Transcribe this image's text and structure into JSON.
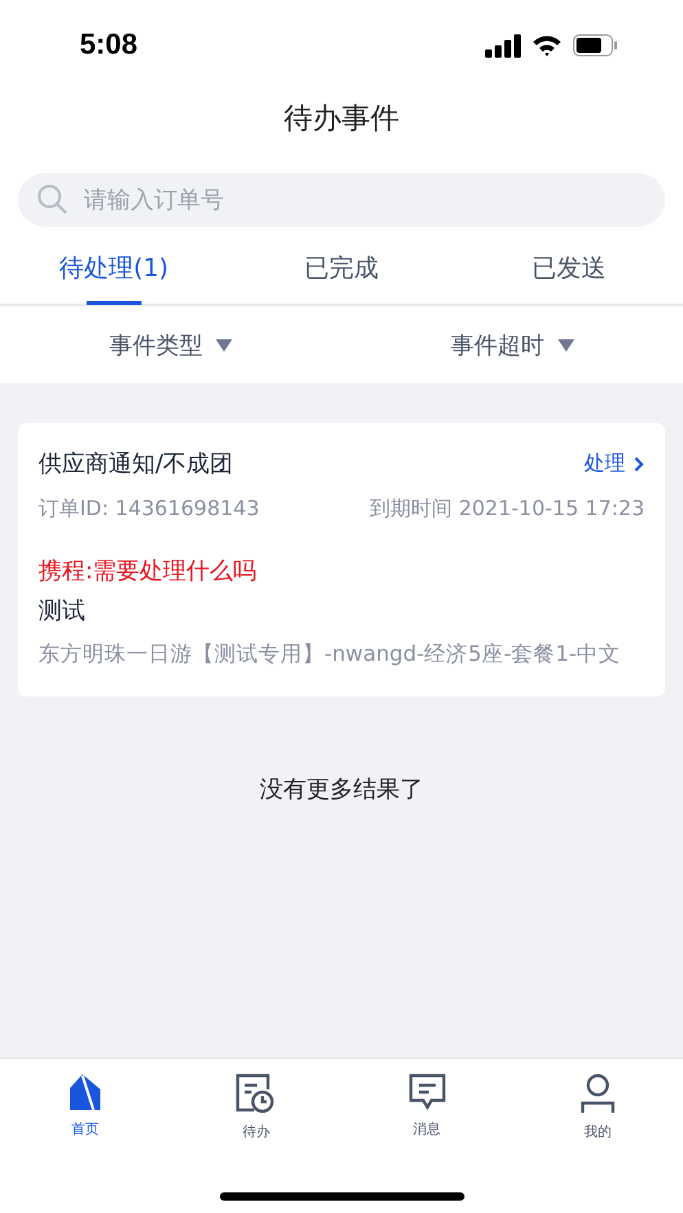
{
  "status_bar": {
    "time": "5:08"
  },
  "title": "待办事件",
  "search": {
    "placeholder": "请输入订单号"
  },
  "tabs": [
    {
      "label": "待处理(1)",
      "selected": true
    },
    {
      "label": "已完成",
      "selected": false
    },
    {
      "label": "已发送",
      "selected": false
    }
  ],
  "filters": [
    {
      "label": "事件类型"
    },
    {
      "label": "事件超时"
    }
  ],
  "events": [
    {
      "title": "供应商通知/不成团",
      "action": "处理",
      "order_id": "订单ID: 14361698143",
      "due": "到期时间 2021-10-15 17:23",
      "alert": "携程:需要处理什么吗",
      "note": "测试",
      "product": "东方明珠一日游【测试专用】-nwangd-经济5座-套餐1-中文"
    }
  ],
  "end_message": "没有更多结果了",
  "nav": [
    {
      "kind": "home",
      "label": "首页",
      "selected": true
    },
    {
      "kind": "todo",
      "label": "待办",
      "selected": false
    },
    {
      "kind": "message",
      "label": "消息",
      "selected": false
    },
    {
      "kind": "profile",
      "label": "我的",
      "selected": false
    }
  ]
}
